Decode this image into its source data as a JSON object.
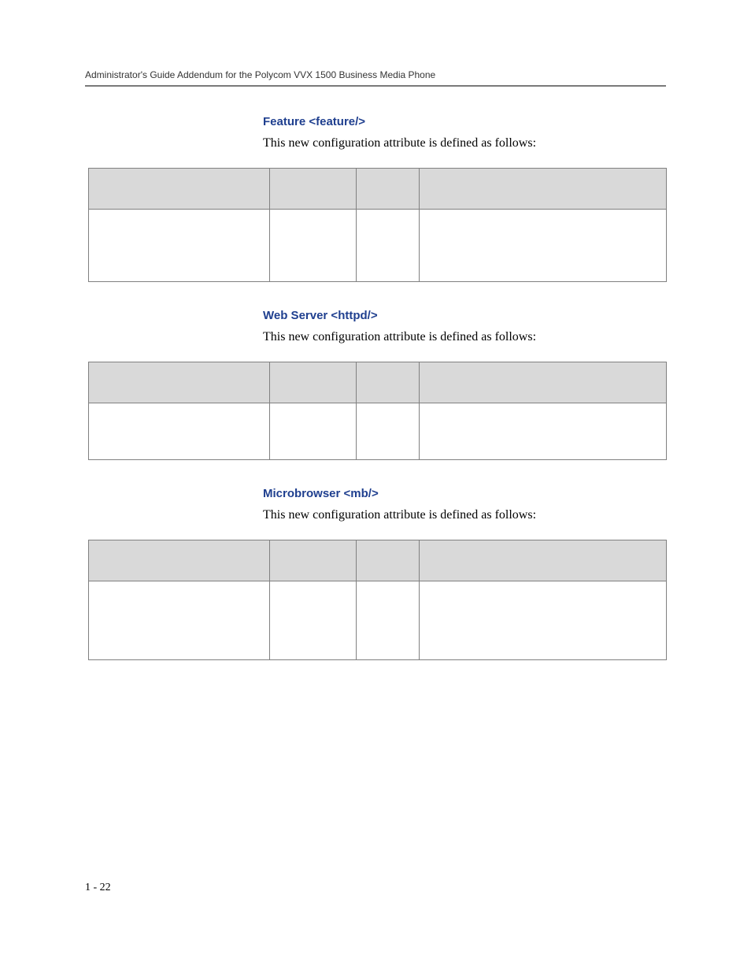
{
  "header": {
    "running_head": "Administrator's Guide Addendum for the Polycom VVX 1500 Business Media Phone"
  },
  "sections": [
    {
      "title": "Feature <feature/>",
      "intro": "This new configuration attribute is defined as follows:",
      "table": {
        "headers": [
          "",
          "",
          "",
          ""
        ],
        "rows": [
          [
            "",
            "",
            "",
            ""
          ]
        ]
      }
    },
    {
      "title": "Web Server <httpd/>",
      "intro": "This new configuration attribute is defined as follows:",
      "table": {
        "headers": [
          "",
          "",
          "",
          ""
        ],
        "rows": [
          [
            "",
            "",
            "",
            ""
          ]
        ]
      }
    },
    {
      "title": "Microbrowser <mb/>",
      "intro": "This new configuration attribute is defined as follows:",
      "table": {
        "headers": [
          "",
          "",
          "",
          ""
        ],
        "rows": [
          [
            "",
            "",
            "",
            ""
          ]
        ]
      }
    }
  ],
  "footer": {
    "page_number": "1 - 22"
  }
}
